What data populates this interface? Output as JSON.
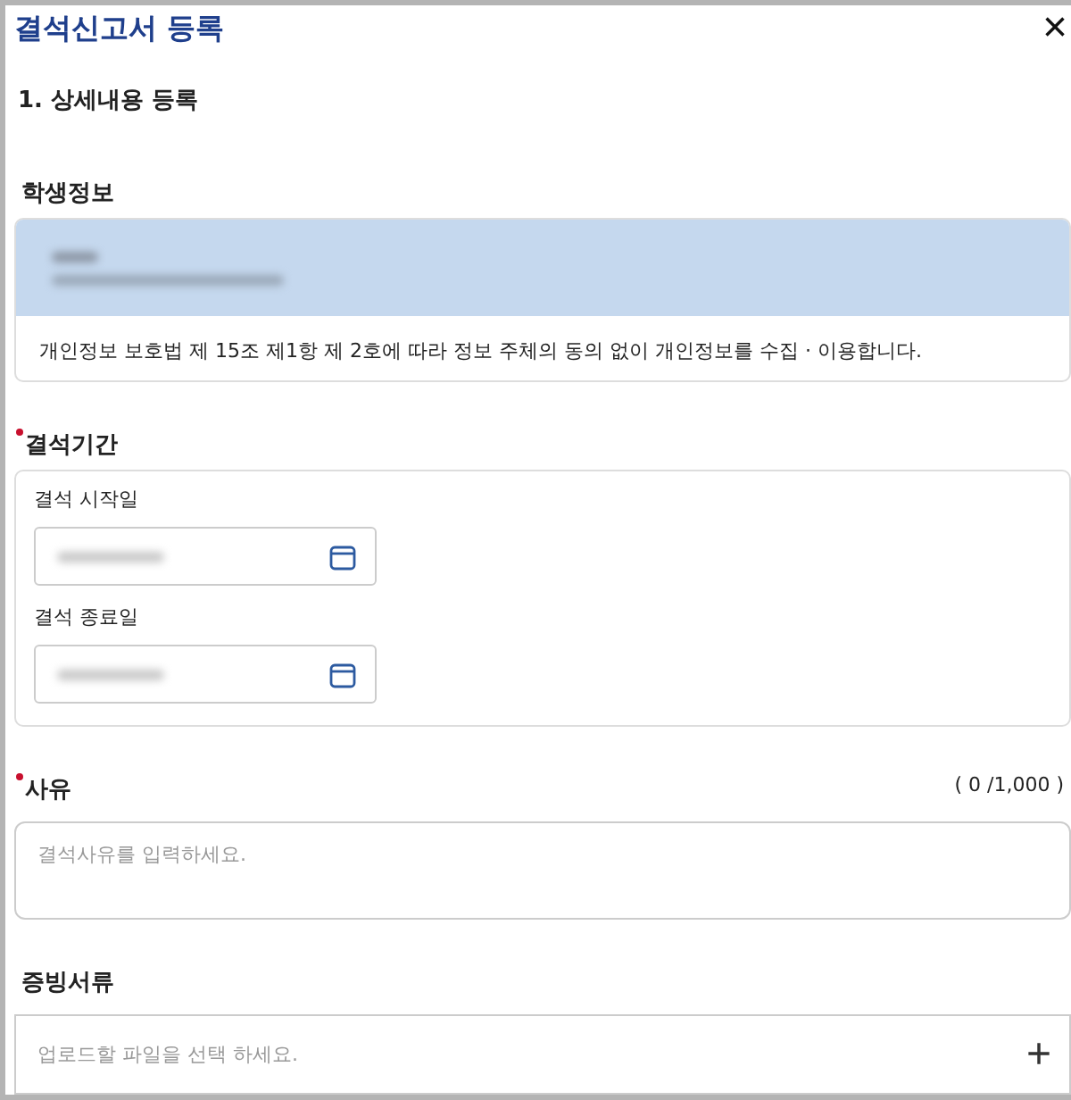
{
  "window": {
    "title": "결석신고서 등록",
    "close": "×"
  },
  "step": {
    "title": "1. 상세내용 등록"
  },
  "student": {
    "label": "학생정보",
    "redacted": true,
    "notice": "개인정보 보호법 제 15조 제1항 제 2호에 따라 정보 주체의 동의 없이 개인정보를 수집 · 이용합니다."
  },
  "period": {
    "label": "결석기간",
    "required": true,
    "fields": [
      {
        "label": "결석 시작일",
        "redacted": true
      },
      {
        "label": "결석 종료일",
        "redacted": true
      }
    ]
  },
  "reason": {
    "label": "사유",
    "required": true,
    "counter": "( 0 /1,000 )",
    "placeholder": "결석사유를 입력하세요."
  },
  "attachments": {
    "label": "증빙서류",
    "required": false,
    "placeholder": "업로드할 파일을 선택 하세요.",
    "add": "+"
  }
}
